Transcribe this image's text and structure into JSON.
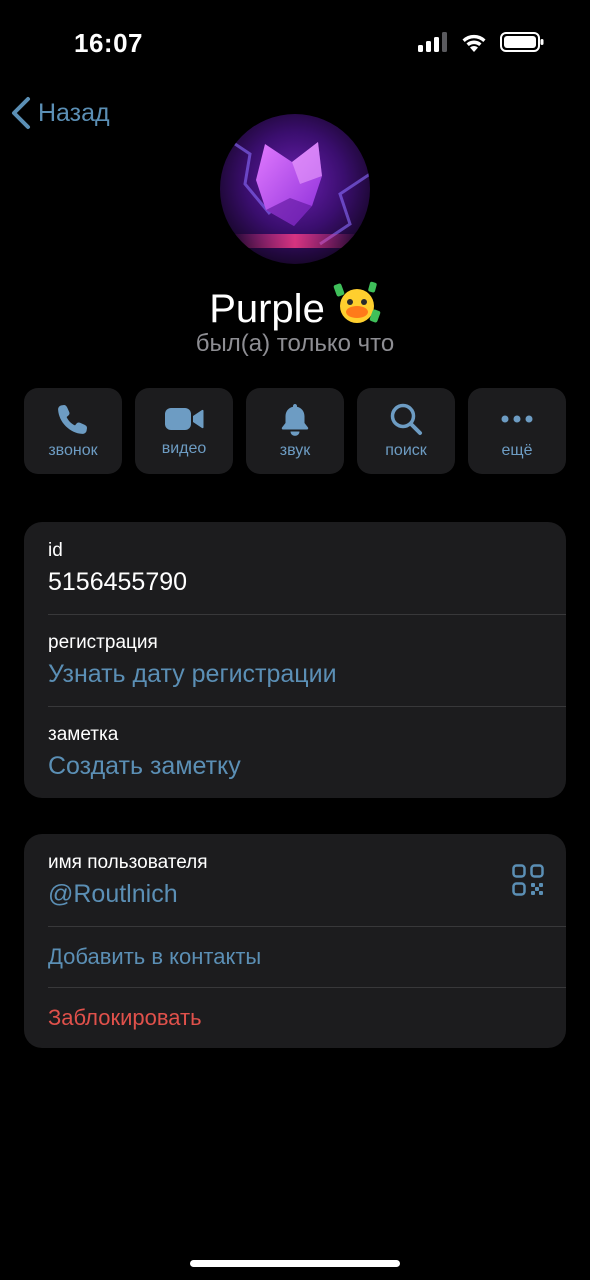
{
  "status_bar": {
    "time": "16:07"
  },
  "nav": {
    "back_label": "Назад"
  },
  "profile": {
    "name": "Purple",
    "status": "был(а) только что",
    "emoji": "🐥"
  },
  "actions": [
    {
      "label": "звонок",
      "icon": "phone-icon"
    },
    {
      "label": "видео",
      "icon": "video-camera-icon"
    },
    {
      "label": "звук",
      "icon": "bell-icon"
    },
    {
      "label": "поиск",
      "icon": "search-icon"
    },
    {
      "label": "ещё",
      "icon": "more-dots-icon"
    }
  ],
  "info": {
    "id_label": "id",
    "id_value": "5156455790",
    "registration_label": "регистрация",
    "registration_value": "Узнать дату регистрации",
    "note_label": "заметка",
    "note_value": "Создать заметку"
  },
  "contact": {
    "username_label": "имя пользователя",
    "username_value": "@Routlnich",
    "add_contact": "Добавить в контакты",
    "block": "Заблокировать"
  },
  "colors": {
    "background": "#000000",
    "card": "#1c1c1e",
    "accent": "#5b8fb5",
    "danger": "#e0514b",
    "secondary_text": "#8e8e93"
  }
}
